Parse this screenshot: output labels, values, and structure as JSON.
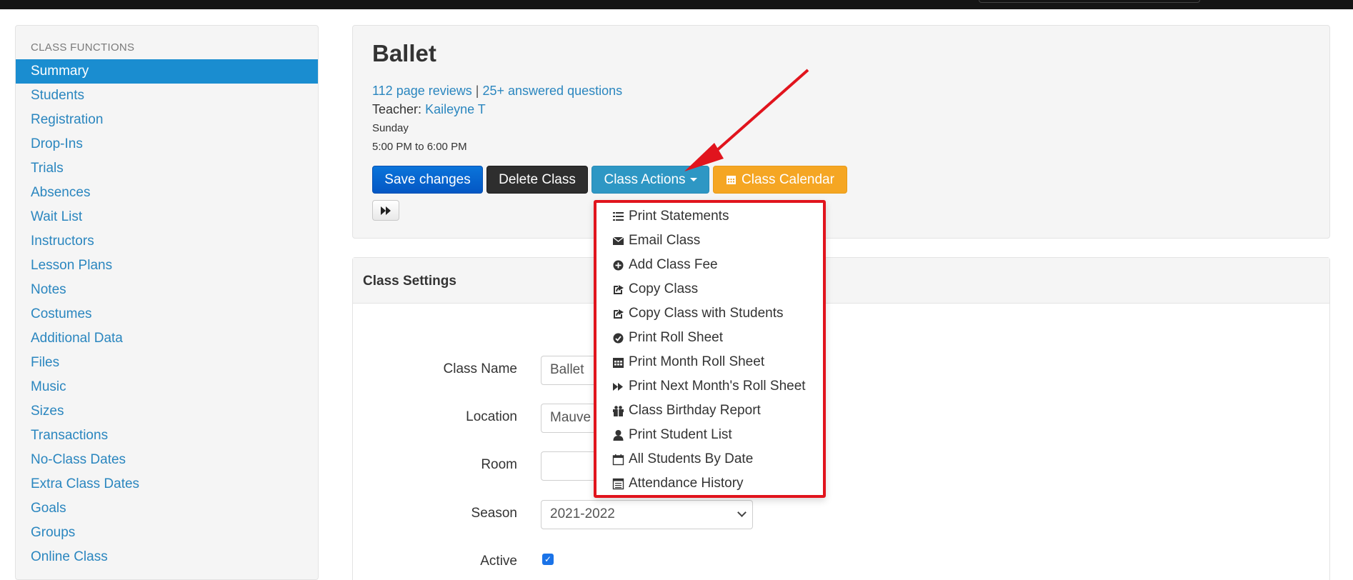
{
  "sidebar": {
    "heading": "CLASS FUNCTIONS",
    "items": [
      {
        "label": "Summary",
        "active": true
      },
      {
        "label": "Students"
      },
      {
        "label": "Registration"
      },
      {
        "label": "Drop-Ins"
      },
      {
        "label": "Trials"
      },
      {
        "label": "Absences"
      },
      {
        "label": "Wait List"
      },
      {
        "label": "Instructors"
      },
      {
        "label": "Lesson Plans"
      },
      {
        "label": "Notes"
      },
      {
        "label": "Costumes"
      },
      {
        "label": "Additional Data"
      },
      {
        "label": "Files"
      },
      {
        "label": "Music"
      },
      {
        "label": "Sizes"
      },
      {
        "label": "Transactions"
      },
      {
        "label": "No-Class Dates"
      },
      {
        "label": "Extra Class Dates"
      },
      {
        "label": "Goals"
      },
      {
        "label": "Groups"
      },
      {
        "label": "Online Class"
      }
    ]
  },
  "header": {
    "title": "Ballet",
    "reviews_link": "112 page reviews",
    "separator": "|",
    "questions_link": "25+ answered questions",
    "teacher_label": "Teacher:",
    "teacher_name": "Kaileyne T",
    "day": "Sunday",
    "time": "5:00 PM to 6:00 PM"
  },
  "buttons": {
    "save": "Save changes",
    "delete": "Delete Class",
    "actions": "Class Actions",
    "calendar": "Class Calendar"
  },
  "dropdown": {
    "items": [
      {
        "label": "Print Statements",
        "icon": "list-icon"
      },
      {
        "label": "Email Class",
        "icon": "envelope-icon"
      },
      {
        "label": "Add Class Fee",
        "icon": "plus-circle-icon"
      },
      {
        "label": "Copy Class",
        "icon": "share-icon"
      },
      {
        "label": "Copy Class with Students",
        "icon": "share-icon"
      },
      {
        "label": "Print Roll Sheet",
        "icon": "check-circle-icon"
      },
      {
        "label": "Print Month Roll Sheet",
        "icon": "calendar-icon"
      },
      {
        "label": "Print Next Month's Roll Sheet",
        "icon": "fast-forward-icon"
      },
      {
        "label": "Class Birthday Report",
        "icon": "gift-icon"
      },
      {
        "label": "Print Student List",
        "icon": "user-icon"
      },
      {
        "label": "All Students By Date",
        "icon": "calendar-outline-icon"
      },
      {
        "label": "Attendance History",
        "icon": "table-icon"
      }
    ]
  },
  "settings": {
    "title": "Class Settings",
    "class_name_label": "Class Name",
    "class_name_value": "Ballet",
    "location_label": "Location",
    "location_value": "Mauve",
    "room_label": "Room",
    "room_value": "",
    "season_label": "Season",
    "season_value": "2021-2022",
    "active_label": "Active",
    "active_checked": true
  },
  "colors": {
    "link": "#2a86bf",
    "active_nav": "#1a8dd0",
    "annotation": "#e1141d"
  }
}
